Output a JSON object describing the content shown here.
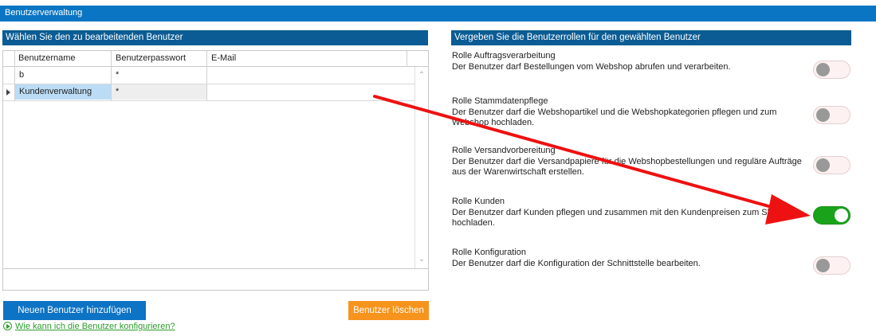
{
  "header": {
    "title": "Benutzerverwaltung"
  },
  "users_panel": {
    "title": "Wählen Sie den zu bearbeitenden Benutzer",
    "columns": [
      "Benutzername",
      "Benutzerpasswort",
      "E-Mail"
    ],
    "rows": [
      {
        "name": "b",
        "password": "*",
        "email": ""
      },
      {
        "name": "Kundenverwaltung",
        "password": "*",
        "email": "",
        "selected": true
      }
    ],
    "add_button": "Neuen Benutzer hinzufügen",
    "delete_button": "Benutzer löschen",
    "help_link": "Wie kann ich die Benutzer konfigurieren?"
  },
  "roles_panel": {
    "title": "Vergeben Sie die Benutzerrollen für den gewählten Benutzer",
    "roles": [
      {
        "title": "Rolle Auftragsverarbeitung",
        "description": "Der Benutzer darf Bestellungen vom Webshop abrufen und verarbeiten.",
        "enabled": false
      },
      {
        "title": "Rolle Stammdatenpflege",
        "description": "Der Benutzer darf die Webshopartikel und die Webshopkategorien pflegen und zum Webshop hochladen.",
        "enabled": false
      },
      {
        "title": "Rolle Versandvorbereitung",
        "description": "Der Benutzer darf die Versandpapiere für die Webshopbestellungen und reguläre Aufträge aus der Warenwirtschaft erstellen.",
        "enabled": false
      },
      {
        "title": "Rolle Kunden",
        "description": "Der Benutzer darf Kunden pflegen und zusammen mit den Kundenpreisen zum Shop hochladen.",
        "enabled": true
      },
      {
        "title": "Rolle Konfiguration",
        "description": "Der Benutzer darf die Konfiguration der Schnittstelle bearbeiten.",
        "enabled": false
      }
    ]
  },
  "colors": {
    "topbar": "#0a75c2",
    "panel_header": "#0b5c94",
    "toggle_on": "#1aa31a",
    "orange": "#f7941d",
    "arrow": "#ee1111"
  }
}
